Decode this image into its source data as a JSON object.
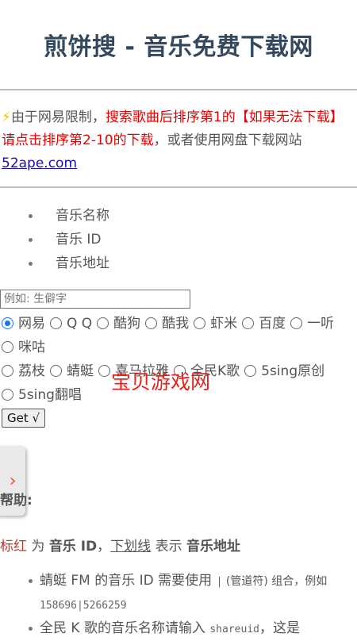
{
  "header": {
    "title": "煎饼搜 - 音乐免费下载网"
  },
  "notice": {
    "icon": "⚡",
    "part1": "由于网易限制，",
    "red": "搜索歌曲后排序第1的【如果无法下载】 请点击排序第2-10的下载",
    "part2": "，或者使用网盘下载网站",
    "link": "52ape.com"
  },
  "modes": [
    "音乐名称",
    "音乐 ID",
    "音乐地址"
  ],
  "search": {
    "placeholder": "例如: 生僻字",
    "value": ""
  },
  "sources": [
    {
      "label": "网易",
      "checked": true
    },
    {
      "label": "Q Q",
      "checked": false
    },
    {
      "label": "酷狗",
      "checked": false
    },
    {
      "label": "酷我",
      "checked": false
    },
    {
      "label": "虾米",
      "checked": false
    },
    {
      "label": "百度",
      "checked": false
    },
    {
      "label": "一听",
      "checked": false
    },
    {
      "label": "咪咕",
      "checked": false
    },
    {
      "label": "荔枝",
      "checked": false
    },
    {
      "label": "蜻蜓",
      "checked": false
    },
    {
      "label": "喜马拉雅",
      "checked": false
    },
    {
      "label": "全民K歌",
      "checked": false
    },
    {
      "label": "5sing原创",
      "checked": false
    },
    {
      "label": "5sing翻唱",
      "checked": false
    }
  ],
  "get_button": "Get √",
  "watermark": "宝贝游戏网",
  "side_tab": {
    "arrow": "›"
  },
  "help": {
    "title": "帮助:",
    "legend_red": "标红",
    "legend_as": " 为 ",
    "legend_id": "音乐 ID",
    "legend_sep": "，",
    "legend_underline": "下划线",
    "legend_means": " 表示 ",
    "legend_addr": "音乐地址",
    "item1_a": "蜻蜓 FM 的音乐 ID 需要使用 ",
    "item1_code": "|",
    "item1_b": " (管道符) 组合，例如 ",
    "item1_example": "158696|5266259",
    "item2_a": "全民 K 歌的音乐名称请输入 ",
    "item2_code": "shareuid",
    "item2_b": "，这是"
  }
}
